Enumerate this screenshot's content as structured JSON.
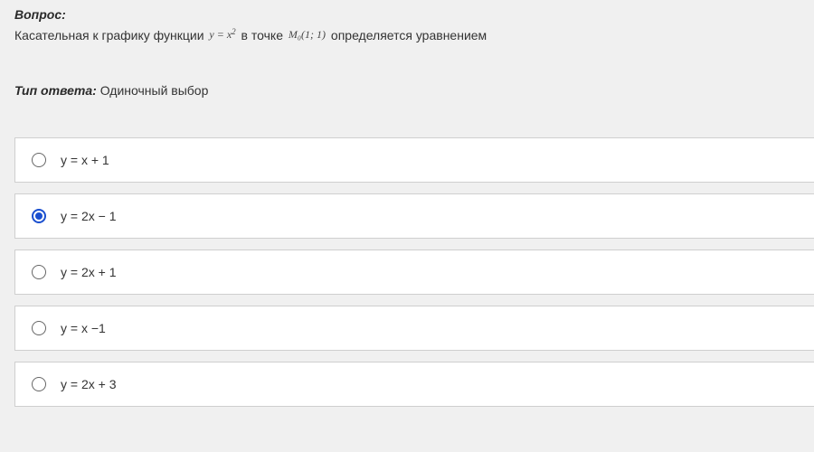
{
  "question": {
    "label": "Вопрос:",
    "text_before": "Касательная к графику функции ",
    "formula1_html": "y = x<sup>2</sup>",
    "text_mid": " в точке ",
    "formula2_html": "M₀(1; 1)",
    "text_after": "  определяется уравнением"
  },
  "answer_type": {
    "label": "Тип ответа:",
    "value": " Одиночный выбор"
  },
  "options": [
    {
      "label": "y = x + 1",
      "selected": false
    },
    {
      "label": "y = 2x − 1",
      "selected": true
    },
    {
      "label": "y = 2x + 1",
      "selected": false
    },
    {
      "label": "y = x −1",
      "selected": false
    },
    {
      "label": "y = 2x + 3",
      "selected": false
    }
  ]
}
